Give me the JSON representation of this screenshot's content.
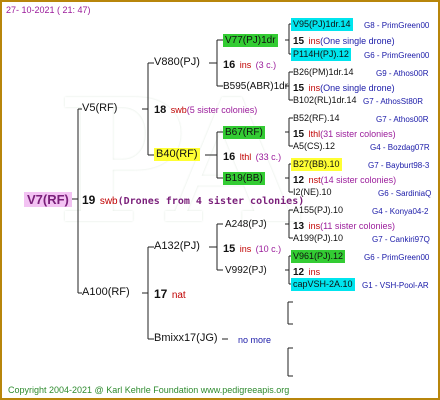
{
  "date": "27- 10-2021 ( 21: 47)",
  "copyright": "Copyright 2004-2021 @ Karl Kehrle Foundation    www.pedigreeapis.org",
  "root": {
    "name": "V7(RF)",
    "gen": "19",
    "ins": "swb",
    "desc": "(Drones from 4 sister colonies)"
  },
  "g1": [
    {
      "name": "V5(RF)"
    },
    {
      "name": "A100(RF)",
      "gen": "17",
      "ins": "nat"
    }
  ],
  "g2": [
    {
      "name": "V880(PJ)"
    },
    {
      "name": "B40(RF)",
      "gen": "18",
      "ins": "swb",
      "desc": "(5 sister colonies)"
    },
    {
      "name": "A132(PJ)",
      "gen": "15",
      "ins": "ins",
      "desc": "(10 c.)"
    },
    {
      "name": "Bmixx17(JG)",
      "nomore": "no more"
    }
  ],
  "g3": [
    {
      "name": "V77(PJ)1dr",
      "gen": "16",
      "ins": "ins",
      "desc": "(3 c.)"
    },
    {
      "name": "B595(ABR)1dr"
    },
    {
      "name": "B67(RF)"
    },
    {
      "name": "B19(BB)",
      "gen": "16",
      "ins": "lthl",
      "desc": "(33 c.)"
    },
    {
      "name": "A248(PJ)"
    },
    {
      "name": "V992(PJ)"
    }
  ],
  "g4": [
    {
      "name": "V95(PJ)1dr.14",
      "loc": "G8 - PrimGreen00"
    },
    {
      "gen": "15",
      "ins": "ins",
      "desc": "(One single drone)"
    },
    {
      "name": "P114H(PJ).12",
      "loc": "G6 - PrimGreen00"
    },
    {
      "name": "B26(PM)1dr.14",
      "loc": "G9 - Athos00R"
    },
    {
      "gen": "15",
      "ins": "ins",
      "desc": "(One single drone)"
    },
    {
      "name": "B102(RL)1dr.14",
      "loc": "G7 - AthosSt80R"
    },
    {
      "name": "B52(RF).14",
      "loc": "G7 - Athos00R"
    },
    {
      "gen": "15",
      "ins": "lthl",
      "desc": "(31 sister colonies)"
    },
    {
      "name": "A5(CS).12",
      "loc": "G4 - Bozdag07R"
    },
    {
      "name": "B27(BB).10",
      "loc": "G7 - Bayburt98-3"
    },
    {
      "gen": "12",
      "ins": "nst",
      "desc": "(14 sister colonies)"
    },
    {
      "name": "I2(NE).10",
      "loc": "G6 - SardiniaQ"
    },
    {
      "name": "A155(PJ).10",
      "loc": "G4 - Konya04-2"
    },
    {
      "gen": "13",
      "ins": "ins",
      "desc": "(11 sister colonies)"
    },
    {
      "name": "A199(PJ).10",
      "loc": "G7 - Cankiri97Q"
    },
    {
      "name": "V961(PJ).12",
      "loc": "G6 - PrimGreen00"
    },
    {
      "gen": "12",
      "ins": "ins",
      "desc": ""
    },
    {
      "name": "capVSH-2A.10",
      "loc": "G1 - VSH-Pool-AR"
    }
  ],
  "watermark": "PA",
  "colors": {
    "border": "#b8860b",
    "yellow": "#ffff33",
    "green": "#33cc33",
    "cyan": "#00e5ee",
    "purple": "#f3c2f3",
    "ins_red": "#c00000",
    "loc_blue": "#1a1aa8"
  }
}
